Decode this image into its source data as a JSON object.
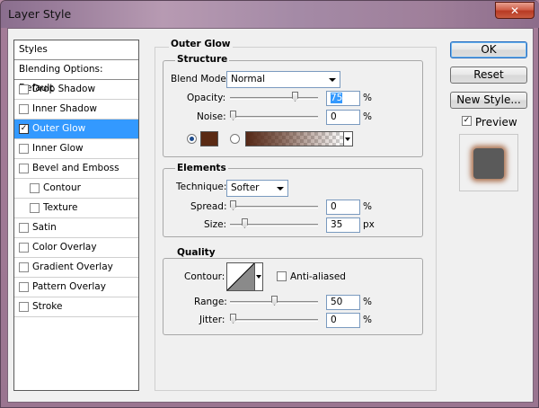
{
  "window": {
    "title": "Layer Style",
    "close_glyph": "✕"
  },
  "sidebar": {
    "header": "Styles",
    "blending": "Blending Options: Default",
    "items": [
      {
        "label": "Drop Shadow",
        "checked": false
      },
      {
        "label": "Inner Shadow",
        "checked": false
      },
      {
        "label": "Outer Glow",
        "checked": true,
        "selected": true
      },
      {
        "label": "Inner Glow",
        "checked": false
      },
      {
        "label": "Bevel and Emboss",
        "checked": false
      },
      {
        "label": "Contour",
        "checked": false,
        "indent": true
      },
      {
        "label": "Texture",
        "checked": false,
        "indent": true
      },
      {
        "label": "Satin",
        "checked": false
      },
      {
        "label": "Color Overlay",
        "checked": false
      },
      {
        "label": "Gradient Overlay",
        "checked": false
      },
      {
        "label": "Pattern Overlay",
        "checked": false
      },
      {
        "label": "Stroke",
        "checked": false
      }
    ],
    "check_glyph": "✓"
  },
  "panel": {
    "title": "Outer Glow",
    "structure": {
      "title": "Structure",
      "blend_mode_label": "Blend Mode:",
      "blend_mode_value": "Normal",
      "opacity_label": "Opacity:",
      "opacity_value": "75",
      "opacity_level": 0.75,
      "opacity_unit": "%",
      "noise_label": "Noise:",
      "noise_value": "0",
      "noise_level": 0,
      "noise_unit": "%",
      "glow_color": "#5a2a14"
    },
    "elements": {
      "title": "Elements",
      "technique_label": "Technique:",
      "technique_value": "Softer",
      "spread_label": "Spread:",
      "spread_value": "0",
      "spread_level": 0,
      "spread_unit": "%",
      "size_label": "Size:",
      "size_value": "35",
      "size_level": 0.14,
      "size_unit": "px"
    },
    "quality": {
      "title": "Quality",
      "contour_label": "Contour:",
      "anti_aliased_label": "Anti-aliased",
      "anti_aliased": false,
      "range_label": "Range:",
      "range_value": "50",
      "range_level": 0.5,
      "range_unit": "%",
      "jitter_label": "Jitter:",
      "jitter_value": "0",
      "jitter_level": 0,
      "jitter_unit": "%"
    }
  },
  "buttons": {
    "ok": "OK",
    "reset": "Reset",
    "new_style": "New Style...",
    "preview_label": "Preview",
    "preview_checked": true
  }
}
